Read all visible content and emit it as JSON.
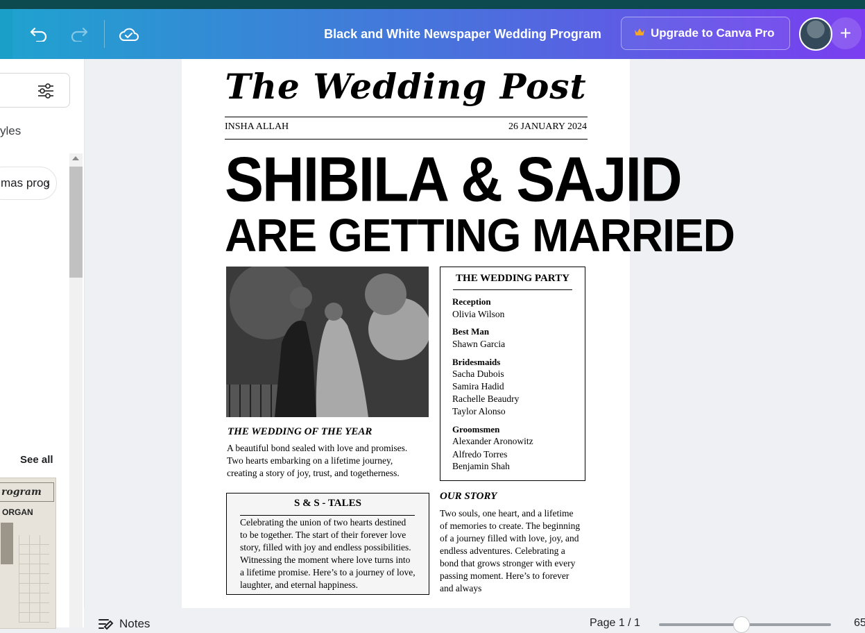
{
  "toolbar": {
    "document_title": "Black and White Newspaper Wedding Program",
    "upgrade_label": "Upgrade to Canva Pro",
    "icons": [
      "undo-icon",
      "redo-icon",
      "cloud-saved-icon",
      "crown-icon",
      "plus-icon"
    ]
  },
  "sidebar": {
    "styles_text": "yles",
    "chip_label": "mas prog",
    "see_all": "See all",
    "thumbnail": {
      "title": "rogram",
      "name": "ORGAN"
    }
  },
  "page": {
    "masthead": "The Wedding Post",
    "dateline_left": "INSHA ALLAH",
    "dateline_right": "26 JANUARY 2024",
    "headline_1": "SHIBILA & SAJID",
    "headline_2": "ARE GETTING MARRIED",
    "wedding_of_year": {
      "title": "THE WEDDING OF THE YEAR",
      "lines": [
        "A beautiful bond sealed with love and promises.",
        "Two hearts embarking on a lifetime journey,",
        "creating a story of joy, trust, and togetherness."
      ]
    },
    "wedding_party": {
      "title": "THE WEDDING PARTY",
      "groups": [
        {
          "role": "Reception",
          "names": [
            "Olivia Wilson"
          ]
        },
        {
          "role": "Best Man",
          "names": [
            "Shawn Garcia"
          ]
        },
        {
          "role": "Bridesmaids",
          "names": [
            "Sacha Dubois",
            "Samira Hadid",
            "Rachelle Beaudry",
            "Taylor Alonso"
          ]
        },
        {
          "role": "Groomsmen",
          "names": [
            "Alexander Aronowitz",
            "Alfredo Torres",
            "Benjamin Shah"
          ]
        }
      ]
    },
    "tales": {
      "title": "S & S - TALES",
      "lines": [
        "Celebrating the union of two hearts destined",
        "to be together. The start of their forever love",
        "story, filled with joy and endless possibilities.",
        "Witnessing the moment where love turns into",
        "a lifetime promise. Here’s to a journey of love,",
        "laughter, and eternal happiness."
      ]
    },
    "our_story": {
      "title": "OUR STORY",
      "lines": [
        "Two souls, one heart, and a lifetime",
        "of memories to create. The beginning",
        "of a journey filled with love, joy, and",
        "endless adventures. Celebrating a",
        "bond that grows stronger with every",
        "passing moment. Here’s to forever",
        "and always"
      ]
    }
  },
  "bottombar": {
    "notes_label": "Notes",
    "page_indicator": "Page 1 / 1",
    "zoom_label": "65",
    "zoom_slider_fraction": 0.48
  }
}
